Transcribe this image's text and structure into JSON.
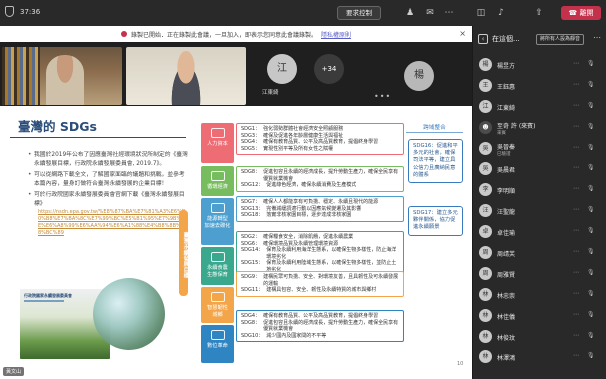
{
  "topbar": {
    "time": "37:36",
    "request_control": "要求控制",
    "leave": "離開",
    "icons": [
      "shield-icon",
      "participants-icon",
      "chat-icon",
      "more-icon",
      "camera-off-icon",
      "mic-off-icon",
      "share-icon"
    ]
  },
  "banner": {
    "text": "錄製已開始．正在錄製此會議，一旦加入，即表示您同意此會議錄製。",
    "link": "隱私權原則"
  },
  "strip": {
    "tiles": [
      {
        "name": "",
        "type": "video"
      },
      {
        "name": "",
        "type": "video"
      }
    ],
    "avatar_j": "江",
    "avatar_j_name": "江東綺",
    "more_count": "+34",
    "avatar_y": "楊",
    "dots": "•••"
  },
  "slide": {
    "title": "臺灣的 SDGs",
    "bullets": [
      {
        "text": "我國於2019年公布了因應臺灣社經環境狀況所制定的《臺灣永續發展目標，行政院永續發展委員會, 2019.7》。"
      },
      {
        "text": "可以從網路下載全文，了解國家面臨的議題和挑戰，並參考本篇內容，量身訂做符合臺灣永續發展的企業目標！"
      },
      {
        "text": "可於行政院國家永續發展委員會官網下載《臺灣永續發展目標》",
        "url": "https://nsdn.epa.gov.tw/%E8%87%BA%E7%81%A3%E6%B0%B8%E7%BA%8C%E7%99%BC%E5%B1%95%E7%9B%AE%E6%A8%99%E6%AA%94%E6%A1%88%E4%B8%8B%E8%BC%89"
      }
    ],
    "book_title": "行政院國家永續發展委員會",
    "vertical_label": "臺灣永續發展目標",
    "categories": [
      {
        "label": "人力資本",
        "color": "#ee6d74"
      },
      {
        "label": "循環經濟",
        "color": "#78bc60"
      },
      {
        "label": "能源轉型\n加速去碳化",
        "color": "#4d9fd0"
      },
      {
        "label": "永續食農\n生態保育",
        "color": "#3aa88c"
      },
      {
        "label": "智慧韌性\n城鄉",
        "color": "#f3a54a"
      },
      {
        "label": "數位革命",
        "color": "#2f84c2"
      }
    ],
    "sdg_groups": [
      {
        "border": "#ee6d74",
        "rows": [
          [
            "SDG1：",
            "強化弱勢群體社會經濟安全照顧服務"
          ],
          [
            "SDG3：",
            "確保及促進各年齡層健康生活與福祉"
          ],
          [
            "SDG4：",
            "確保有教育品質、公平及高品質教育，提倡終身學習"
          ],
          [
            "SDG5：",
            "實現性別平等及所有女性之賦權"
          ]
        ]
      },
      {
        "border": "#78bc60",
        "rows": [
          [
            "SDG8：",
            "促進包容且永續的經濟成長，提升勞動生產力，確保全民享有優質就業機會"
          ],
          [
            "SDG12：",
            "促進綠色經濟，確保永續消費及生產模式"
          ]
        ]
      },
      {
        "border": "#4d9fd0",
        "rows": [
          [
            "SDG7：",
            "確保人人都能享有可負擔、穩定、永續且現代的能源"
          ],
          [
            "SDG13：",
            "完備減緩調適行動以因應氣候變遷及其影響"
          ],
          [
            "SDG18：",
            "落實非核家園目標，逐步達成非核家園"
          ]
        ]
      },
      {
        "border": "#3aa88c",
        "rows": [
          [
            "SDG2：",
            "確保糧食安全，消除飢餓，促進永續農業"
          ],
          [
            "SDG6：",
            "確保環境品質及永續管理環境資源"
          ],
          [
            "SDG14：",
            "保育及永續利用海洋生態系，以確保生物多樣性，防止海洋環境劣化"
          ],
          [
            "SDG15：",
            "保育及永續利用陸域生態系，以確保生物多樣性，並防止土地劣化"
          ]
        ]
      },
      {
        "border": "#f3a54a",
        "rows": [
          [
            "SDG9：",
            "建構民眾可負擔、安全、對環境友善，且具韌性及可永續發展的運輸"
          ],
          [
            "SDG11：",
            "建構具包容、安全、韌性及永續特質的城市與鄉村"
          ]
        ]
      },
      {
        "border": "#2f84c2",
        "rows": [
          [
            "SDG4：",
            "確保有教育品質、公平及高品質教育，提倡終身學習"
          ],
          [
            "SDG8：",
            "促進包容且永續的經濟成長，提升勞動生產力，確保全民享有優質就業機會"
          ],
          [
            "SDG10：",
            "減少國內及國家間的不平等"
          ]
        ]
      }
    ],
    "side_title": "跨域整合",
    "side_boxes": [
      "SDG16：促進和平多元的社會，確保司法平等，建立具公信力且廣納民意的體系",
      "SDG17：建立多元夥伴關係，協力促進永續願景"
    ],
    "page_number": "10",
    "presenter_tag": "黃文山"
  },
  "panel": {
    "title": "在這個...",
    "mute_all": "將所有人設為靜音",
    "participants": [
      {
        "initial": "楊",
        "name": "楊昱方"
      },
      {
        "initial": "王",
        "name": "王鈺惠"
      },
      {
        "initial": "江",
        "name": "江東綺"
      },
      {
        "initial": "",
        "name": "至奇 許 (來賓)",
        "sub": "來賓",
        "dark": true
      },
      {
        "initial": "吳",
        "name": "吳晉秦",
        "sub": "已驗證"
      },
      {
        "initial": "吳",
        "name": "吳晨君"
      },
      {
        "initial": "李",
        "name": "李明順"
      },
      {
        "initial": "汪",
        "name": "汪聖龍"
      },
      {
        "initial": "卓",
        "name": "卓佳瑜"
      },
      {
        "initial": "周",
        "name": "周靖芙"
      },
      {
        "initial": "周",
        "name": "周雅賢"
      },
      {
        "initial": "林",
        "name": "林忠崇"
      },
      {
        "initial": "林",
        "name": "林佳儀"
      },
      {
        "initial": "林",
        "name": "林俊玟"
      },
      {
        "initial": "林",
        "name": "林澤鴻"
      }
    ]
  }
}
